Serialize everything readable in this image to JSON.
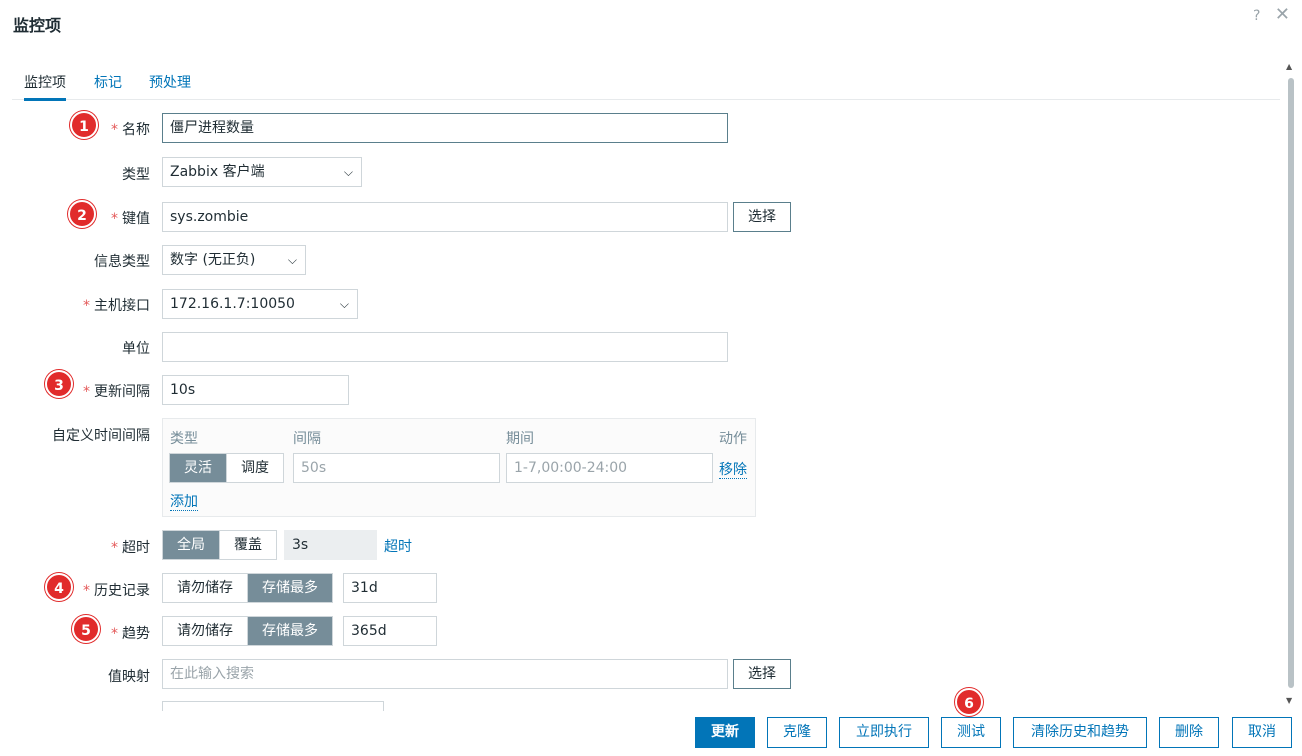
{
  "window": {
    "title": "监控项",
    "help_icon": "?",
    "close_icon": "✕"
  },
  "tabs": [
    {
      "label": "监控项",
      "active": true
    },
    {
      "label": "标记",
      "active": false
    },
    {
      "label": "预处理",
      "active": false
    }
  ],
  "form": {
    "name": {
      "label": "名称",
      "value": "僵尸进程数量",
      "badge": "1"
    },
    "type": {
      "label": "类型",
      "value": "Zabbix 客户端"
    },
    "key": {
      "label": "键值",
      "value": "sys.zombie",
      "select_button": "选择",
      "badge": "2"
    },
    "info_type": {
      "label": "信息类型",
      "value": "数字 (无正负)"
    },
    "host_interface": {
      "label": "主机接口",
      "value": "172.16.1.7:10050"
    },
    "units": {
      "label": "单位",
      "value": ""
    },
    "update_interval": {
      "label": "更新间隔",
      "value": "10s",
      "badge": "3"
    },
    "custom_intervals": {
      "label": "自定义时间间隔",
      "headers": {
        "type": "类型",
        "interval": "间隔",
        "period": "期间",
        "action": "动作"
      },
      "row": {
        "options": [
          "灵活",
          "调度"
        ],
        "selected": "灵活",
        "interval_placeholder": "50s",
        "period_placeholder": "1-7,00:00-24:00",
        "remove": "移除"
      },
      "add": "添加"
    },
    "timeout": {
      "label": "超时",
      "options": [
        "全局",
        "覆盖"
      ],
      "selected": "全局",
      "value": "3s",
      "link": "超时"
    },
    "history": {
      "label": "历史记录",
      "options": [
        "请勿储存",
        "存储最多"
      ],
      "selected": "存储最多",
      "value": "31d",
      "badge": "4"
    },
    "trends": {
      "label": "趋势",
      "options": [
        "请勿储存",
        "存储最多"
      ],
      "selected": "存储最多",
      "value": "365d",
      "badge": "5"
    },
    "value_map": {
      "label": "值映射",
      "placeholder": "在此输入搜索",
      "select_button": "选择"
    }
  },
  "footer": {
    "buttons": [
      "更新",
      "克隆",
      "立即执行",
      "测试",
      "清除历史和趋势",
      "删除",
      "取消"
    ],
    "test_badge": "6"
  },
  "colors": {
    "accent": "#0275b8",
    "badge": "#e12b2b",
    "segment_on": "#768d99",
    "required": "#e45959"
  }
}
